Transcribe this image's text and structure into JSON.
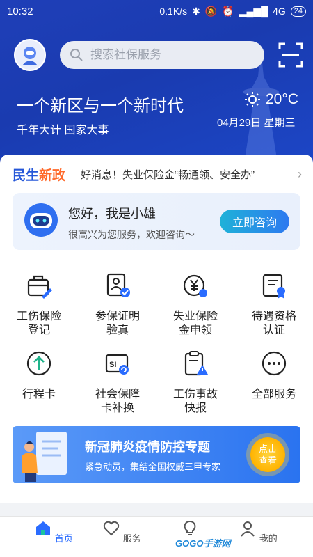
{
  "status_bar": {
    "time": "10:32",
    "speed": "0.1K/s",
    "network": "4G",
    "battery": "24"
  },
  "header": {
    "search_placeholder": "搜索社保服务"
  },
  "hero": {
    "headline": "一个新区与一个新时代",
    "subline": "千年大计 国家大事",
    "temperature": "20°C",
    "date": "04月29日 星期三"
  },
  "policy": {
    "tag_part1": "民生",
    "tag_part2": "新政",
    "news": "好消息！失业保险金“畅通领、安全办”"
  },
  "assistant": {
    "greeting": "您好，我是小雄",
    "subtitle": "很高兴为您服务，欢迎咨询～",
    "button": "立即咨询"
  },
  "services": [
    {
      "line1": "工伤保险",
      "line2": "登记",
      "icon": "briefcase-pen-icon"
    },
    {
      "line1": "参保证明",
      "line2": "验真",
      "icon": "id-card-check-icon"
    },
    {
      "line1": "失业保险",
      "line2": "金申领",
      "icon": "yen-coin-icon"
    },
    {
      "line1": "待遇资格",
      "line2": "认证",
      "icon": "certificate-icon"
    },
    {
      "line1": "行程卡",
      "line2": "",
      "icon": "arrow-up-circle-icon"
    },
    {
      "line1": "社会保障",
      "line2": "卡补换",
      "icon": "si-card-icon"
    },
    {
      "line1": "工伤事故",
      "line2": "快报",
      "icon": "clipboard-warning-icon"
    },
    {
      "line1": "全部服务",
      "line2": "",
      "icon": "more-dots-icon"
    }
  ],
  "banner": {
    "title": "新冠肺炎疫情防控专题",
    "subtitle": "紧急动员，集结全国权威三甲专家",
    "cta_line1": "点击",
    "cta_line2": "查看"
  },
  "tabs": [
    {
      "label": "首页",
      "icon": "home-icon"
    },
    {
      "label": "服务",
      "icon": "heart-hand-icon"
    },
    {
      "label": "",
      "icon": "bulb-icon"
    },
    {
      "label": "我的",
      "icon": "user-icon"
    }
  ],
  "watermark": "GOGO手游网",
  "colors": {
    "hero": "#1f3fb8",
    "accent": "#2a6cff",
    "orange": "#ff6a2b"
  }
}
